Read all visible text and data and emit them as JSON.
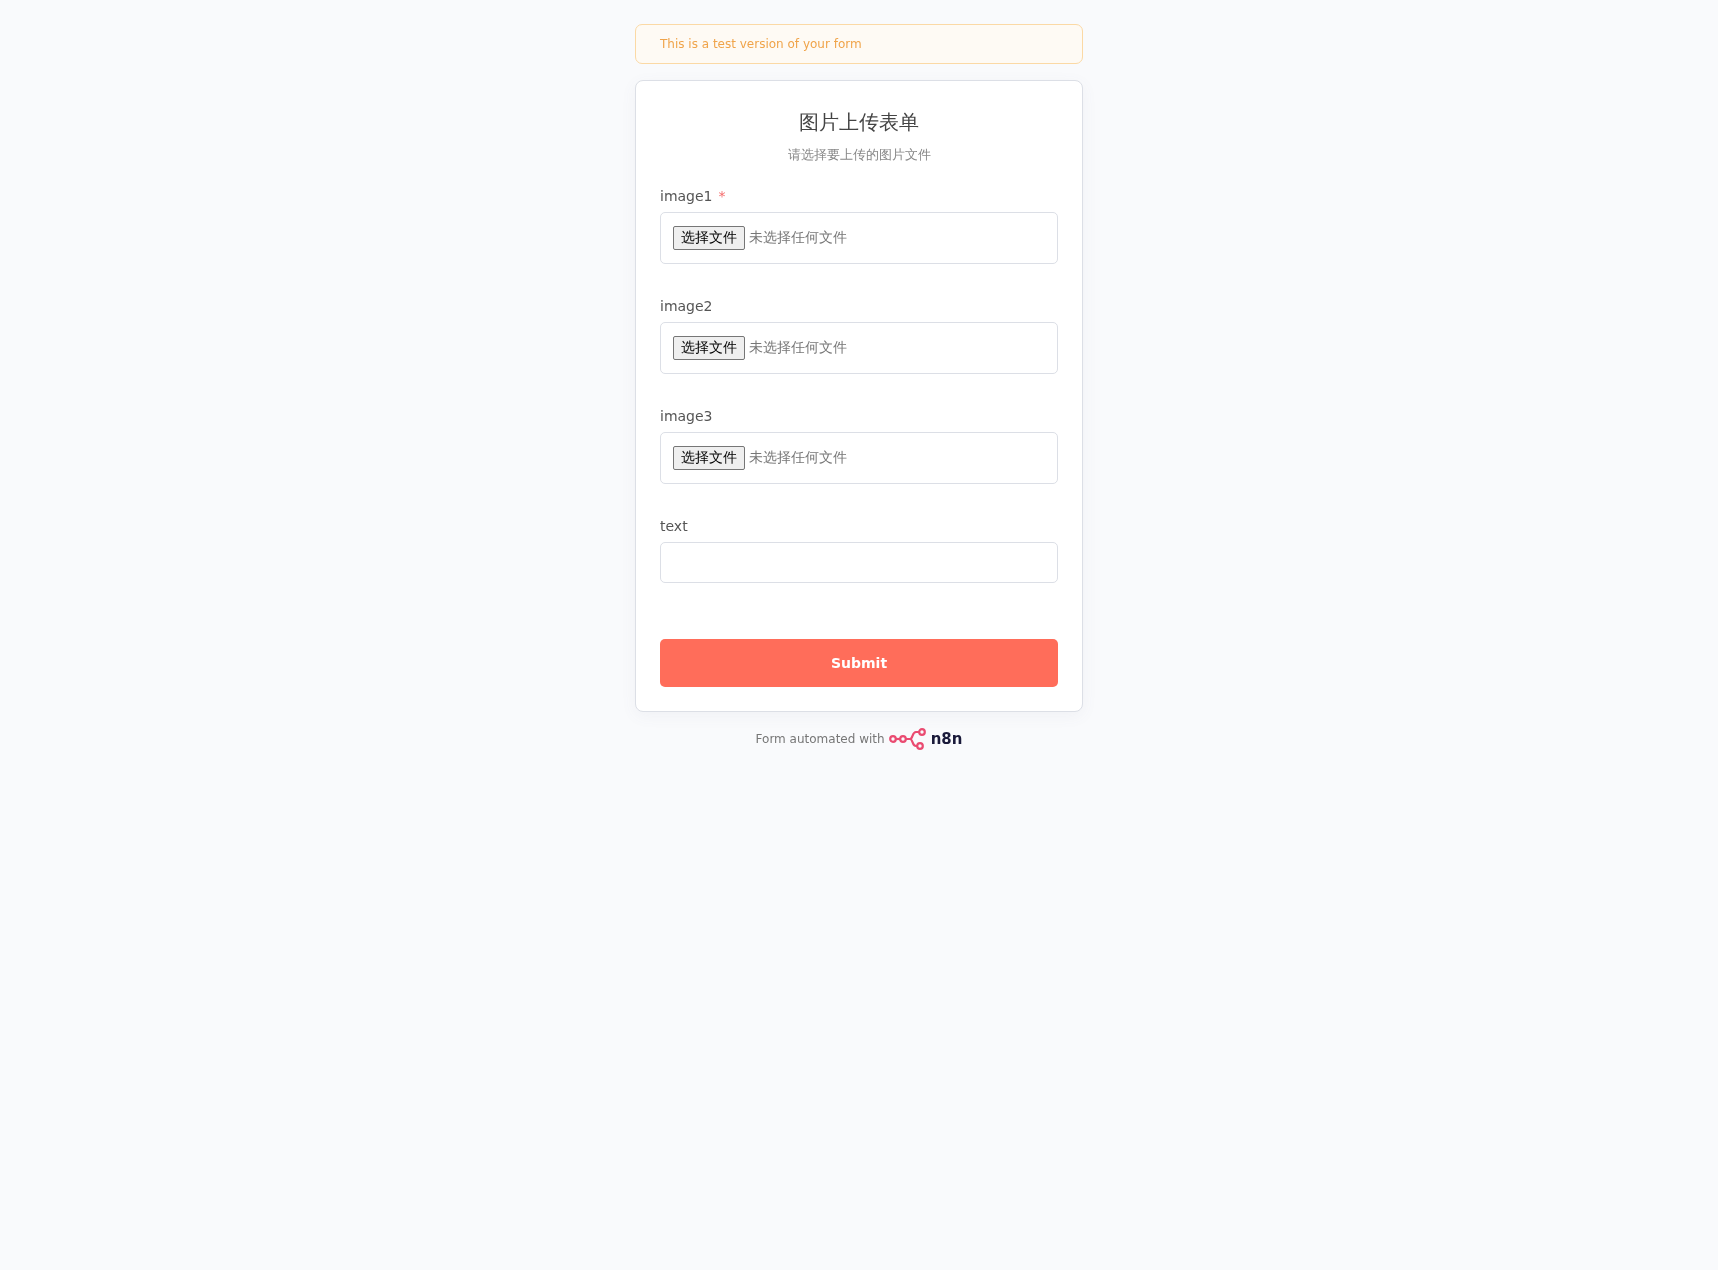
{
  "banner": {
    "text": "This is a test version of your form"
  },
  "form": {
    "title": "图片上传表单",
    "subtitle": "请选择要上传的图片文件",
    "fields": [
      {
        "kind": "file",
        "label": "image1",
        "required_mark": "*",
        "button": "选择文件",
        "status": "未选择任何文件"
      },
      {
        "kind": "file",
        "label": "image2",
        "button": "选择文件",
        "status": "未选择任何文件"
      },
      {
        "kind": "file",
        "label": "image3",
        "button": "选择文件",
        "status": "未选择任何文件"
      },
      {
        "kind": "text",
        "label": "text"
      }
    ],
    "submit": "Submit"
  },
  "footer": {
    "text": "Form automated with",
    "brand": "n8n"
  }
}
